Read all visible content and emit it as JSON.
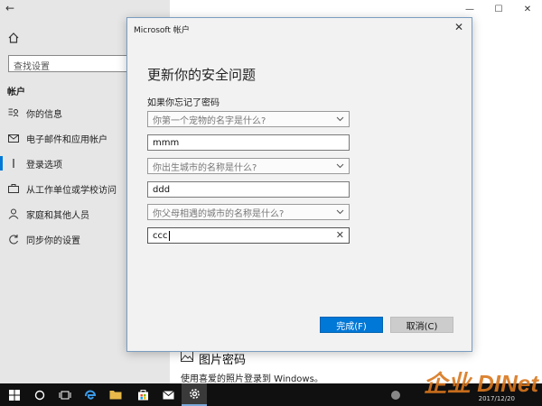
{
  "settings": {
    "search_placeholder": "查找设置",
    "section": "帐户",
    "nav": [
      {
        "label": "你的信息",
        "icon": "profile-card-icon"
      },
      {
        "label": "电子邮件和应用帐户",
        "icon": "mail-icon"
      },
      {
        "label": "登录选项",
        "icon": "key-icon",
        "active": true
      },
      {
        "label": "从工作单位或学校访问",
        "icon": "briefcase-icon"
      },
      {
        "label": "家庭和其他人员",
        "icon": "person-icon"
      },
      {
        "label": "同步你的设置",
        "icon": "sync-icon"
      }
    ],
    "picture_password": {
      "title": "图片密码",
      "description": "使用喜爱的照片登录到 Windows。"
    },
    "window_controls": {
      "minimize": "—",
      "maximize": "☐",
      "close": "✕"
    }
  },
  "dialog": {
    "title": "Microsoft 帐户",
    "heading": "更新你的安全问题",
    "subheading": "如果你忘记了密码",
    "q1": "你第一个宠物的名字是什么?",
    "a1": "mmm",
    "q2": "你出生城市的名称是什么?",
    "a2": "ddd",
    "q3": "你父母相遇的城市的名称是什么?",
    "a3": "ccc",
    "ok_label": "完成(F)",
    "cancel_label": "取消(C)"
  },
  "taskbar": {
    "date": "2017/12/20",
    "watermark": "企业 DINet"
  },
  "colors": {
    "accent": "#0078d7",
    "sidebar_bg": "#e6e6e6",
    "taskbar_bg": "#101010"
  }
}
